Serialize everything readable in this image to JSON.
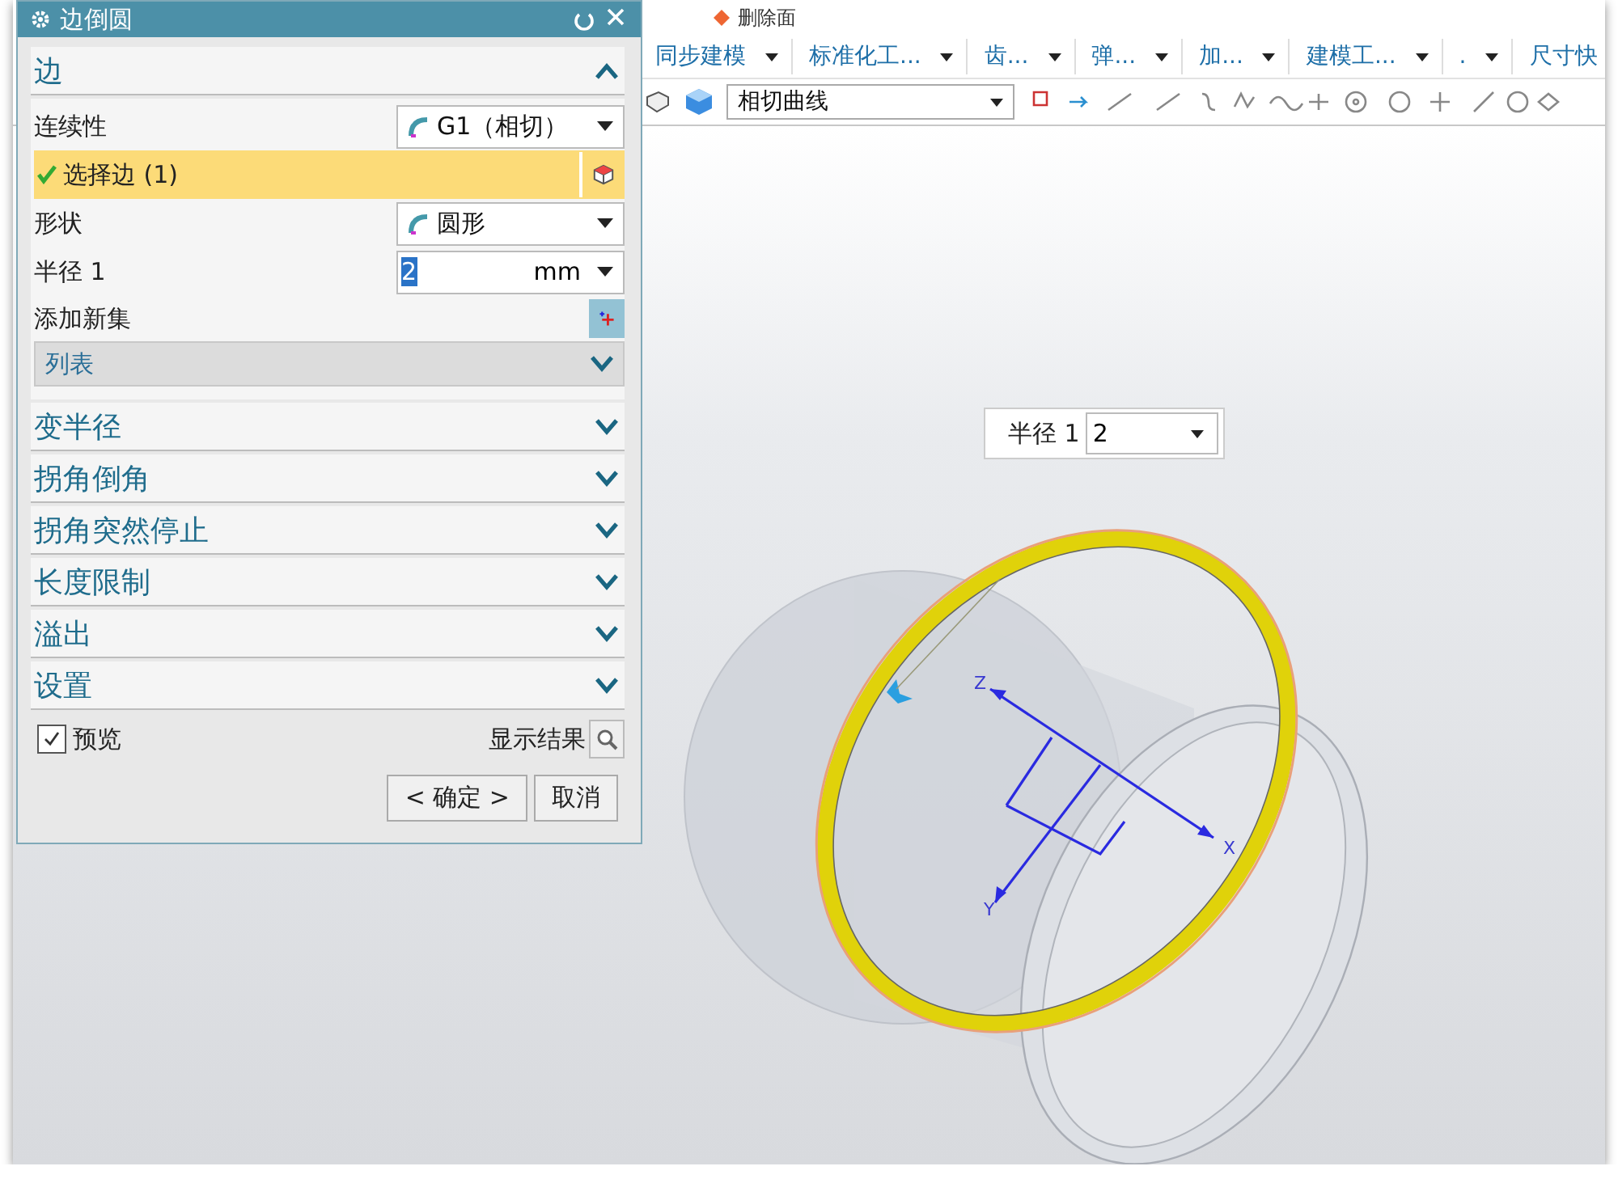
{
  "ribbon": {
    "top_item": {
      "label": "删除面"
    },
    "groups": [
      {
        "label": "同步建模"
      },
      {
        "label": "标准化工..."
      },
      {
        "label": "齿..."
      },
      {
        "label": "弹..."
      },
      {
        "label": "加..."
      },
      {
        "label": "建模工..."
      },
      {
        "label": "."
      },
      {
        "label": "尺寸快"
      }
    ],
    "curve_rule": {
      "value": "相切曲线"
    }
  },
  "dialog": {
    "title": "边倒圆",
    "sections": [
      {
        "title": "边",
        "expanded": true,
        "rows": [
          {
            "kind": "dropdown",
            "label": "连续性",
            "value": "G1（相切）"
          },
          {
            "kind": "selection",
            "label": "选择边 (1)",
            "complete": true
          },
          {
            "kind": "dropdown",
            "label": "形状",
            "value": "圆形"
          },
          {
            "kind": "number",
            "label": "半径 1",
            "value": "2",
            "unit": "mm"
          },
          {
            "kind": "action",
            "label": "添加新集"
          },
          {
            "kind": "list",
            "label": "列表"
          }
        ]
      },
      {
        "title": "变半径",
        "expanded": false
      },
      {
        "title": "拐角倒角",
        "expanded": false
      },
      {
        "title": "拐角突然停止",
        "expanded": false
      },
      {
        "title": "长度限制",
        "expanded": false
      },
      {
        "title": "溢出",
        "expanded": false
      },
      {
        "title": "设置",
        "expanded": false
      }
    ],
    "preview": {
      "label": "预览",
      "checked": true
    },
    "show_result": "显示结果",
    "buttons": [
      {
        "label": "< 确定 >"
      },
      {
        "label": "取消"
      }
    ]
  },
  "viewport": {
    "radius_popup": {
      "label": "半径 1",
      "value": "2"
    },
    "axes": [
      {
        "label": "Z"
      },
      {
        "label": "X"
      },
      {
        "label": "Y"
      }
    ]
  }
}
